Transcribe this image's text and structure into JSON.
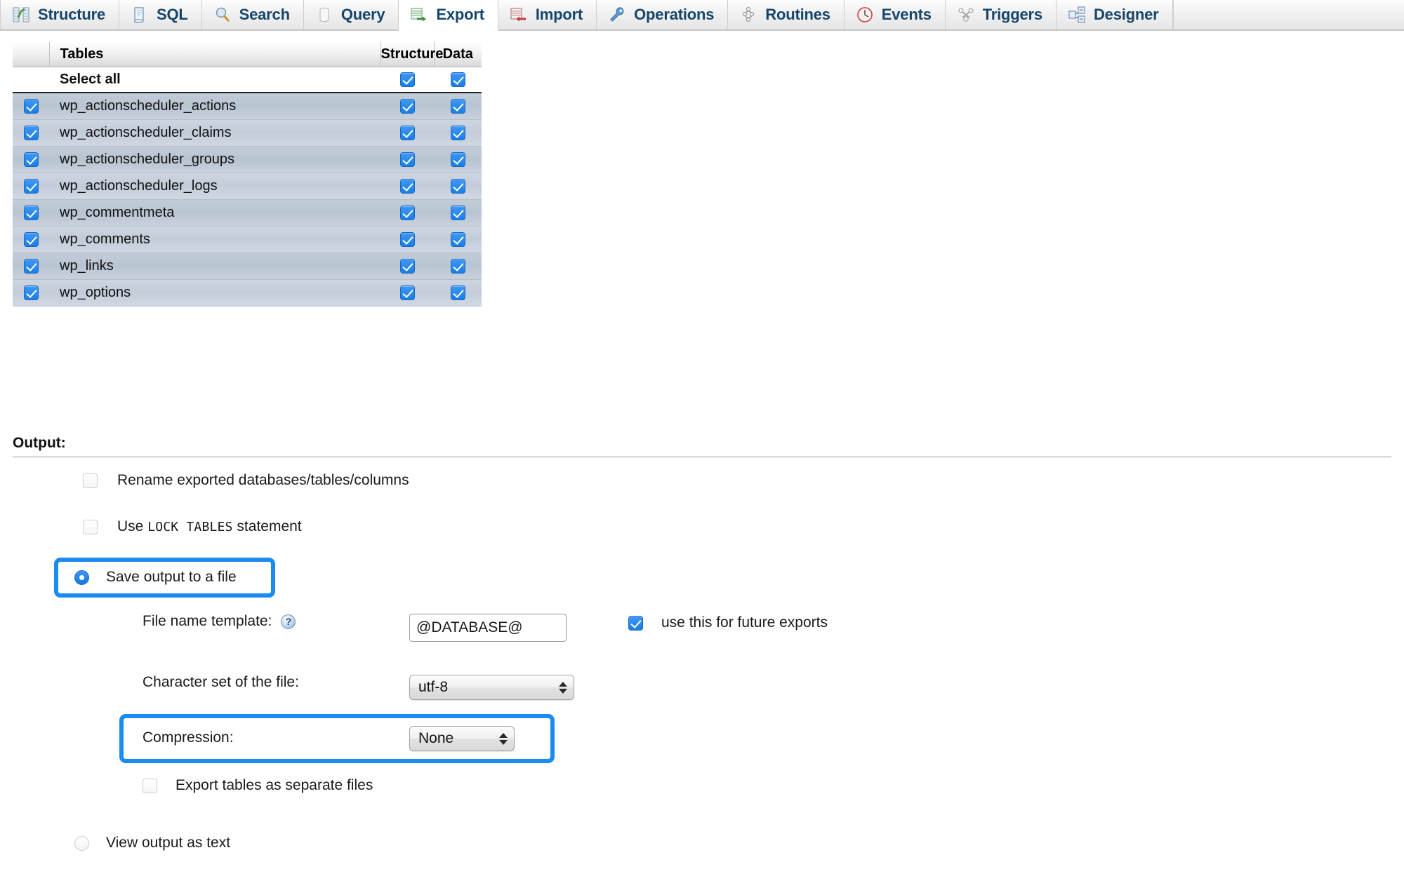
{
  "tabs": [
    {
      "label": "Structure",
      "icon": "structure-icon",
      "active": false
    },
    {
      "label": "SQL",
      "icon": "sql-icon",
      "active": false
    },
    {
      "label": "Search",
      "icon": "search-icon",
      "active": false
    },
    {
      "label": "Query",
      "icon": "query-icon",
      "active": false
    },
    {
      "label": "Export",
      "icon": "export-icon",
      "active": true
    },
    {
      "label": "Import",
      "icon": "import-icon",
      "active": false
    },
    {
      "label": "Operations",
      "icon": "wrench-icon",
      "active": false
    },
    {
      "label": "Routines",
      "icon": "routines-icon",
      "active": false
    },
    {
      "label": "Events",
      "icon": "clock-icon",
      "active": false
    },
    {
      "label": "Triggers",
      "icon": "triggers-icon",
      "active": false
    },
    {
      "label": "Designer",
      "icon": "designer-icon",
      "active": false
    }
  ],
  "tables_panel": {
    "columns": {
      "checkbox": "",
      "tables": "Tables",
      "structure": "Structure",
      "data": "Data"
    },
    "select_all": {
      "label": "Select all",
      "structure_checked": true,
      "data_checked": true
    },
    "rows": [
      {
        "name": "wp_actionscheduler_actions",
        "selected": true,
        "structure": true,
        "data": true
      },
      {
        "name": "wp_actionscheduler_claims",
        "selected": true,
        "structure": true,
        "data": true
      },
      {
        "name": "wp_actionscheduler_groups",
        "selected": true,
        "structure": true,
        "data": true
      },
      {
        "name": "wp_actionscheduler_logs",
        "selected": true,
        "structure": true,
        "data": true
      },
      {
        "name": "wp_commentmeta",
        "selected": true,
        "structure": true,
        "data": true
      },
      {
        "name": "wp_comments",
        "selected": true,
        "structure": true,
        "data": true
      },
      {
        "name": "wp_links",
        "selected": true,
        "structure": true,
        "data": true
      },
      {
        "name": "wp_options",
        "selected": true,
        "structure": true,
        "data": true
      }
    ]
  },
  "output": {
    "heading": "Output:",
    "rename_option": {
      "label": "Rename exported databases/tables/columns",
      "checked": false
    },
    "lock_option": {
      "prefix": "Use ",
      "code": "LOCK TABLES",
      "suffix": " statement",
      "checked": false
    },
    "save_to_file": {
      "label": "Save output to a file",
      "selected": true,
      "highlighted": true
    },
    "file_name_template": {
      "label": "File name template:",
      "help_icon": "help-icon",
      "value": "@DATABASE@",
      "placeholder": "@DATABASE@",
      "future_exports": {
        "label": "use this for future exports",
        "checked": true
      }
    },
    "charset": {
      "label": "Character set of the file:",
      "value": "utf-8"
    },
    "compression": {
      "label": "Compression:",
      "value": "None",
      "highlighted": true
    },
    "separate_files": {
      "label": "Export tables as separate files",
      "checked": false
    },
    "view_as_text": {
      "label": "View output as text",
      "selected": false
    }
  },
  "colors": {
    "accent_blue": "#1a8cf0",
    "checkbox_blue": "#1a7fe8",
    "tab_text": "#16456b",
    "row_band": "#c2ccd9"
  }
}
